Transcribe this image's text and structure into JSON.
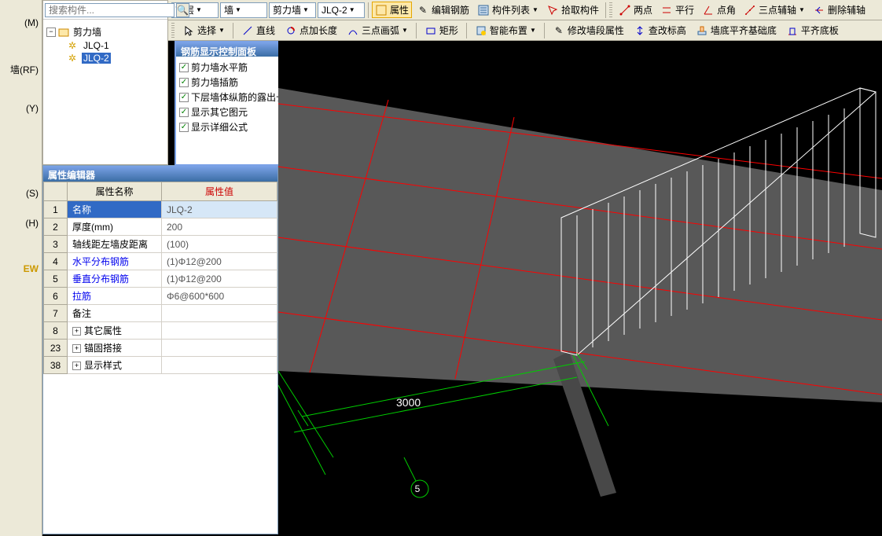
{
  "sidebar_labels": {
    "m": "(M)",
    "rf": "墙(RF)",
    "y": "(Y)",
    "s": "(S)",
    "h": "(H)",
    "ew": "EW"
  },
  "toolbar1": {
    "dd1": "首层",
    "dd2": "墙",
    "dd3": "剪力墙",
    "dd4": "JLQ-2",
    "btn_property": "属性",
    "btn_edit_rebar": "编辑钢筋",
    "btn_component_list": "构件列表",
    "btn_pick": "拾取构件",
    "btn_2pt": "两点",
    "btn_parallel": "平行",
    "btn_pt_angle": "点角",
    "btn_3pt_axis": "三点辅轴",
    "btn_del_axis": "删除辅轴"
  },
  "toolbar2": {
    "btn_select": "选择",
    "btn_line": "直线",
    "btn_pt_len": "点加长度",
    "btn_3pt_arc": "三点画弧",
    "btn_rect": "矩形",
    "btn_smart": "智能布置",
    "btn_mod_seg": "修改墙段属性",
    "btn_check_h": "查改标高",
    "btn_wall_base": "墙底平齐基础底",
    "btn_align_base": "平齐底板"
  },
  "tree": {
    "search_placeholder": "搜索构件...",
    "root": "剪力墙",
    "child1": "JLQ-1",
    "child2": "JLQ-2"
  },
  "prop_panel": {
    "title": "属性编辑器",
    "header_name": "属性名称",
    "header_value": "属性值",
    "rows": [
      {
        "num": "1",
        "name": "名称",
        "value": "JLQ-2",
        "selected": true
      },
      {
        "num": "2",
        "name": "厚度(mm)",
        "value": "200"
      },
      {
        "num": "3",
        "name": "轴线距左墙皮距离",
        "value": "(100)"
      },
      {
        "num": "4",
        "name": "水平分布钢筋",
        "value": "(1)Φ12@200",
        "link": true
      },
      {
        "num": "5",
        "name": "垂直分布钢筋",
        "value": "(1)Φ12@200",
        "link": true
      },
      {
        "num": "6",
        "name": "拉筋",
        "value": "Φ6@600*600",
        "link": true
      },
      {
        "num": "7",
        "name": "备注",
        "value": ""
      },
      {
        "num": "8",
        "name": "其它属性",
        "value": "",
        "expand": true
      },
      {
        "num": "23",
        "name": "锚固搭接",
        "value": "",
        "expand": true
      },
      {
        "num": "38",
        "name": "显示样式",
        "value": "",
        "expand": true
      }
    ]
  },
  "rebar_panel": {
    "title": "钢筋显示控制面板",
    "items": [
      "剪力墙水平筋",
      "剪力墙插筋",
      "下层墙体纵筋的露出长度",
      "显示其它图元",
      "显示详细公式"
    ]
  },
  "viewport": {
    "dimension": "3000",
    "bubble": "5"
  }
}
